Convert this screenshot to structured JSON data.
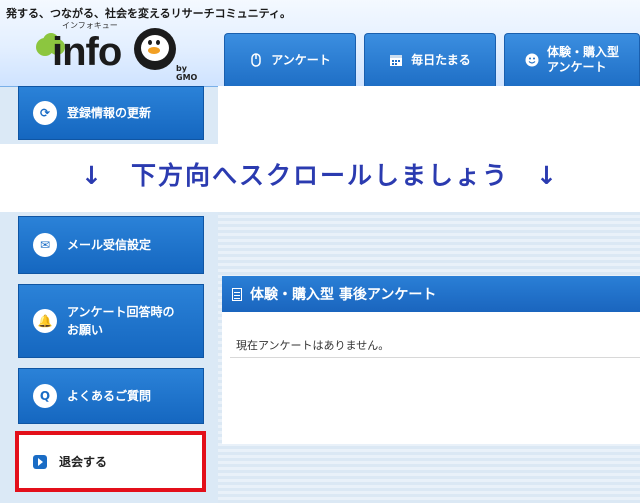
{
  "header": {
    "tagline": "発する、つながる、社会を変えるリサーチコミュニティ。",
    "logo": {
      "small_text": "インフォキュー",
      "main_text": "info",
      "by_text": "by GMO",
      "icon": "owl-q-logo-icon"
    },
    "tabs": [
      {
        "label": "アンケート",
        "icon": "mouse-icon"
      },
      {
        "label": "毎日たまる",
        "icon": "calendar-icon"
      },
      {
        "label_line1": "体験・購入型",
        "label_line2": "アンケート",
        "icon": "smiley-icon"
      }
    ]
  },
  "sidebar": {
    "items": [
      {
        "label": "登録情報の更新",
        "icon": "refresh-icon"
      },
      {
        "label": "メール受信設定",
        "icon": "mail-icon"
      },
      {
        "label_line1": "アンケート回答時の",
        "label_line2": "お願い",
        "icon": "bell-icon"
      },
      {
        "label": "よくあるご質問",
        "icon": "question-icon",
        "icon_text": "Q"
      }
    ],
    "quit": {
      "label": "退会する",
      "icon": "play-icon"
    }
  },
  "overlay": {
    "scroll_hint": "↓　下方向へスクロールしましょう　↓"
  },
  "main": {
    "panel_title": "体験・購入型 事後アンケート",
    "panel_message": "現在アンケートはありません。"
  },
  "colors": {
    "accent_blue": "#1a6cc5",
    "highlight_red": "#e30f1a",
    "hint_text": "#2b3bb0"
  }
}
